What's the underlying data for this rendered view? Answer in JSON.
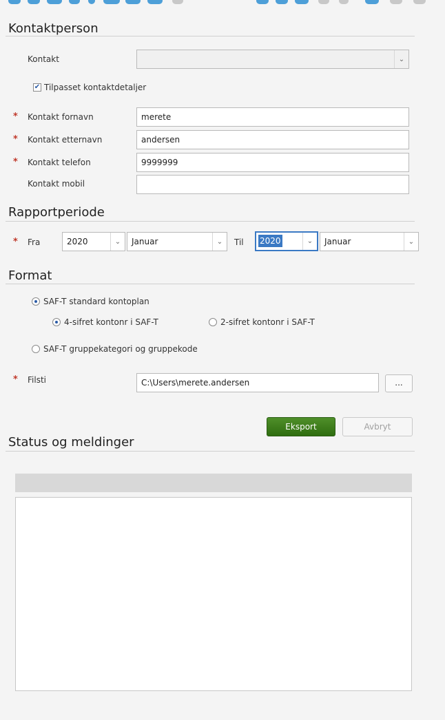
{
  "kontaktperson": {
    "title": "Kontaktperson",
    "kontakt_label": "Kontakt",
    "kontakt_value": "",
    "tilpasset_label": "Tilpasset kontaktdetaljer",
    "tilpasset_checked": true,
    "fornavn_label": "Kontakt fornavn",
    "fornavn_value": "merete",
    "etternavn_label": "Kontakt etternavn",
    "etternavn_value": "andersen",
    "telefon_label": "Kontakt telefon",
    "telefon_value": "9999999",
    "mobil_label": "Kontakt mobil",
    "mobil_value": "",
    "required_mark": "*"
  },
  "rapportperiode": {
    "title": "Rapportperiode",
    "fra_label": "Fra",
    "fra_year": "2020",
    "fra_month": "Januar",
    "til_label": "Til",
    "til_year": "2020",
    "til_month": "Januar"
  },
  "format": {
    "title": "Format",
    "option_standard": "SAF-T standard kontoplan",
    "option_4": "4-sifret kontonr i SAF-T",
    "option_2": "2-sifret kontonr i SAF-T",
    "option_gruppe": "SAF-T gruppekategori og gruppekode",
    "filsti_label": "Filsti",
    "filsti_value": "C:\\Users\\merete.andersen",
    "browse_label": "..."
  },
  "actions": {
    "eksport": "Eksport",
    "avbryt": "Avbryt"
  },
  "status": {
    "title": "Status og meldinger"
  },
  "icons": {
    "toolbar": "toolbar-icons",
    "dropdown": "chevron-down-icon",
    "accent_color": "#4d9fd8",
    "required_color": "#c0392b",
    "primary_button_color": "#3f7d1d"
  }
}
